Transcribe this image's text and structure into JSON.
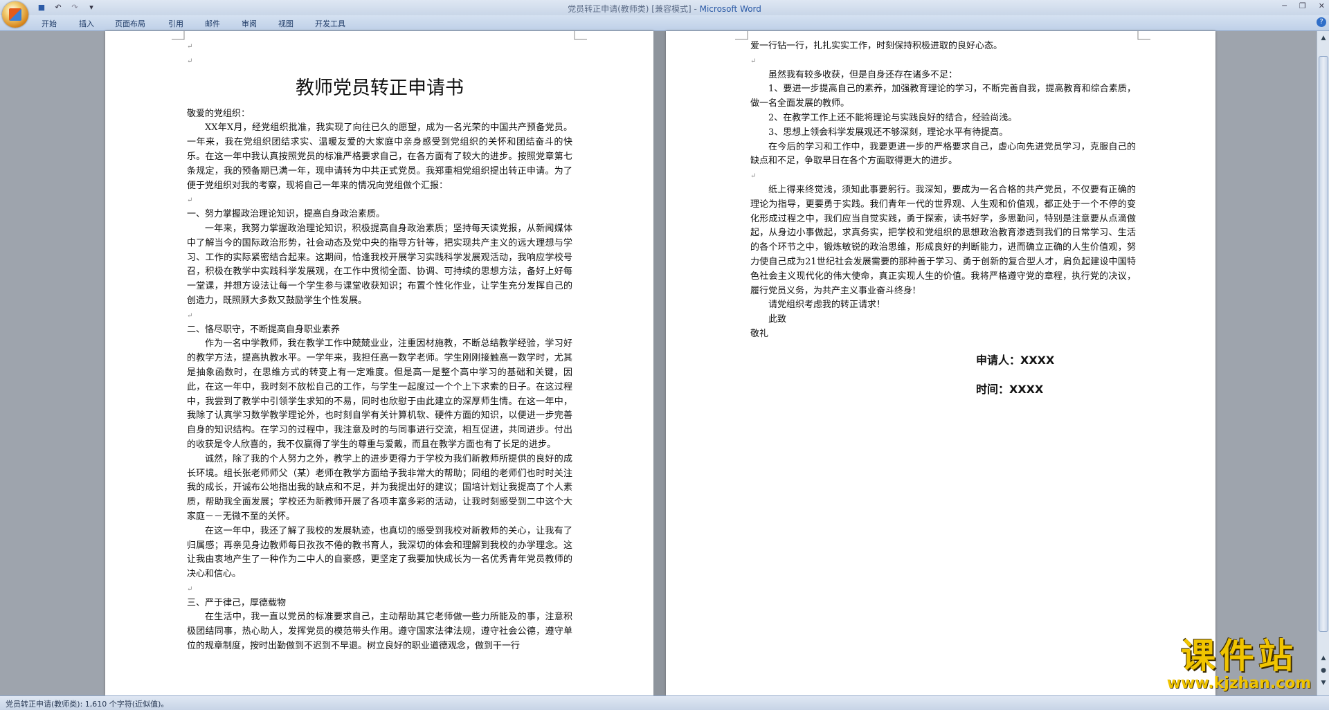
{
  "window": {
    "title_doc": "党员转正申请(教师类) [兼容模式] - ",
    "title_app": "Microsoft Word"
  },
  "ribbon": {
    "tabs": [
      "开始",
      "插入",
      "页面布局",
      "引用",
      "邮件",
      "审阅",
      "视图",
      "开发工具"
    ]
  },
  "document": {
    "title": "教师党员转正申请书",
    "salutation": "敬爱的党组织：",
    "page1": [
      {
        "t": "XX年X月，经党组织批准，我实现了向往已久的愿望，成为一名光荣的中国共产预备党员。一年来，我在党组织团结求实、温暖友爱的大家庭中亲身感受到党组织的关怀和团结奋斗的快乐。在这一年中我认真按照党员的标准严格要求自己，在各方面有了较大的进步。按照党章第七条规定，我的预备期已满一年，现申请转为中共正式党员。我郑重相党组织提出转正申请。为了便于党组织对我的考察，现将自己一年来的情况向党组做个汇报：",
        "i": true
      },
      {
        "t": "",
        "b": true
      },
      {
        "t": "一、努力掌握政治理论知识，提高自身政治素质。",
        "i": false
      },
      {
        "t": "一年来，我努力掌握政治理论知识，积极提高自身政治素质；坚持每天读党报，从新闻媒体中了解当今的国际政治形势，社会动态及党中央的指导方针等，把实现共产主义的远大理想与学习、工作的实际紧密结合起来。这期间，恰逢我校开展学习实践科学发展观活动，我响应学校号召，积极在教学中实践科学发展观，在工作中贯彻全面、协调、可持续的思想方法，备好上好每一堂课，并想方设法让每一个学生参与课堂收获知识；布置个性化作业，让学生充分发挥自己的创造力，既照顾大多数又鼓励学生个性发展。",
        "i": true
      },
      {
        "t": "",
        "b": true
      },
      {
        "t": "二、恪尽职守，不断提高自身职业素养",
        "i": false
      },
      {
        "t": "作为一名中学教师，我在教学工作中兢兢业业，注重因材施教，不断总结教学经验，学习好的教学方法，提高执教水平。一学年来，我担任高一数学老师。学生刚刚接触高一数学时，尤其是抽象函数时，在思维方式的转变上有一定难度。但是高一是整个高中学习的基础和关键，因此，在这一年中，我时刻不放松自己的工作，与学生一起度过一个个上下求索的日子。在这过程中，我尝到了教学中引领学生求知的不易，同时也欣慰于由此建立的深厚师生情。在这一年中，我除了认真学习数学教学理论外，也时刻自学有关计算机软、硬件方面的知识，以便进一步完善自身的知识结构。在学习的过程中，我注意及时的与同事进行交流，相互促进，共同进步。付出的收获是令人欣喜的，我不仅赢得了学生的尊重与爱戴，而且在教学方面也有了长足的进步。",
        "i": true
      },
      {
        "t": "诚然，除了我的个人努力之外，教学上的进步更得力于学校为我们新教师所提供的良好的成长环境。组长张老师师父（某）老师在教学方面给予我非常大的帮助；同组的老师们也时时关注我的成长，开诚布公地指出我的缺点和不足，并为我提出好的建议；国培计划让我提高了个人素质，帮助我全面发展；学校还为新教师开展了各项丰富多彩的活动，让我时刻感受到二中这个大家庭－－无微不至的关怀。",
        "i": true
      },
      {
        "t": "在这一年中，我还了解了我校的发展轨迹，也真切的感受到我校对新教师的关心，让我有了归属感；再亲见身边教师每日孜孜不倦的教书育人，我深切的体会和理解到我校的办学理念。这让我由衷地产生了一种作为二中人的自豪感，更坚定了我要加快成长为一名优秀青年党员教师的决心和信心。",
        "i": true
      },
      {
        "t": "",
        "b": true
      },
      {
        "t": "三、严于律己，厚德载物",
        "i": false
      },
      {
        "t": "在生活中，我一直以党员的标准要求自己，主动帮助其它老师做一些力所能及的事，注意积极团结同事，热心助人，发挥党员的模范带头作用。遵守国家法律法规，遵守社会公德，遵守单位的规章制度，按时出勤做到不迟到不早退。树立良好的职业道德观念，做到干一行",
        "i": true
      }
    ],
    "page2": [
      {
        "t": "爱一行钻一行，扎扎实实工作，时刻保持积极进取的良好心态。",
        "i": false
      },
      {
        "t": "",
        "b": true
      },
      {
        "t": "虽然我有较多收获，但是自身还存在诸多不足：",
        "i": true
      },
      {
        "t": "1、要进一步提高自己的素养，加强教育理论的学习，不断完善自我，提高教育和综合素质，做一名全面发展的教师。",
        "i": true
      },
      {
        "t": "2、在教学工作上还不能将理论与实践良好的结合，经验尚浅。",
        "i": true
      },
      {
        "t": "3、思想上领会科学发展观还不够深刻，理论水平有待提高。",
        "i": true
      },
      {
        "t": "在今后的学习和工作中，我要更进一步的严格要求自己，虚心向先进党员学习，克服自己的缺点和不足，争取早日在各个方面取得更大的进步。",
        "i": true
      },
      {
        "t": "",
        "b": true
      },
      {
        "t": "纸上得来终觉浅，须知此事要躬行。我深知，要成为一名合格的共产党员，不仅要有正确的理论为指导，更要勇于实践。我们青年一代的世界观、人生观和价值观，都正处于一个不停的变化形成过程之中，我们应当自觉实践，勇于探索，读书好学，多思勤问，特别是注意要从点滴做起，从身边小事做起，求真务实，把学校和党组织的思想政治教育渗透到我们的日常学习、生活的各个环节之中，锻炼敏锐的政治思维，形成良好的判断能力，进而确立正确的人生价值观，努力使自己成为21世纪社会发展需要的那种善于学习、勇于创新的复合型人才，肩负起建设中国特色社会主义现代化的伟大使命，真正实现人生的价值。我将严格遵守党的章程，执行党的决议，履行党员义务，为共产主义事业奋斗终身!",
        "i": true
      },
      {
        "t": "请党组织考虑我的转正请求！",
        "i": true
      },
      {
        "t": "此致",
        "i": true
      },
      {
        "t": "敬礼",
        "i": false
      }
    ],
    "applicant": "申请人：XXXX",
    "date": "时间：XXXX"
  },
  "statusbar": {
    "text": "党员转正申请(教师类): 1,610 个字符(近似值)。"
  },
  "watermark": {
    "main": "课件站",
    "url": "www.kjzhan.com"
  }
}
